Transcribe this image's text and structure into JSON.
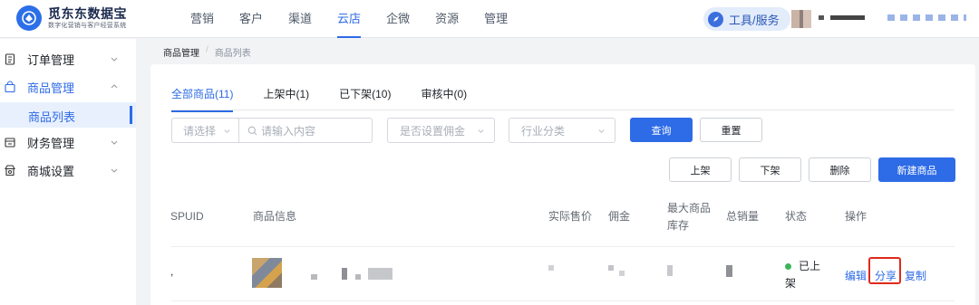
{
  "header": {
    "logo_title": "觅东东数据宝",
    "logo_subtitle": "数字化营销与客户经营系统",
    "nav": [
      {
        "label": "营销",
        "active": false
      },
      {
        "label": "客户",
        "active": false
      },
      {
        "label": "渠道",
        "active": false
      },
      {
        "label": "云店",
        "active": true
      },
      {
        "label": "企微",
        "active": false
      },
      {
        "label": "资源",
        "active": false
      },
      {
        "label": "管理",
        "active": false
      }
    ],
    "tools_label": "工具/服务"
  },
  "sidebar": {
    "items": [
      {
        "label": "订单管理",
        "icon": "clipboard-icon"
      },
      {
        "label": "商品管理",
        "icon": "shopping-bag-icon",
        "expanded": true
      },
      {
        "label": "商品列表",
        "submenu": true,
        "active": true
      },
      {
        "label": "财务管理",
        "icon": "finance-icon"
      },
      {
        "label": "商城设置",
        "icon": "shop-settings-icon"
      }
    ]
  },
  "breadcrumb": [
    "商品管理",
    "商品列表"
  ],
  "tabs": [
    {
      "label": "全部商品(11)",
      "active": true
    },
    {
      "label": "上架中(1)",
      "active": false
    },
    {
      "label": "已下架(10)",
      "active": false
    },
    {
      "label": "审核中(0)",
      "active": false
    }
  ],
  "filters": {
    "select_placeholder": "请选择",
    "search_placeholder": "请输入内容",
    "commission_placeholder": "是否设置佣金",
    "industry_placeholder": "行业分类",
    "query_label": "查询",
    "reset_label": "重置"
  },
  "actions": {
    "list_on": "上架",
    "list_off": "下架",
    "delete": "删除",
    "new_product": "新建商品"
  },
  "table": {
    "headers": {
      "spuid": "SPUID",
      "info": "商品信息",
      "price": "实际售价",
      "commission": "佣金",
      "max_stock": "最大商品库存",
      "total_sales": "总销量",
      "status": "状态",
      "operations": "操作"
    },
    "rows": [
      {
        "spuid": ",",
        "status": "已上架",
        "ops": [
          "编辑",
          "分享",
          "复制"
        ]
      }
    ]
  },
  "colors": {
    "primary": "#2e6be6",
    "status_green": "#3cb55a",
    "highlight_red": "#e0291a"
  }
}
